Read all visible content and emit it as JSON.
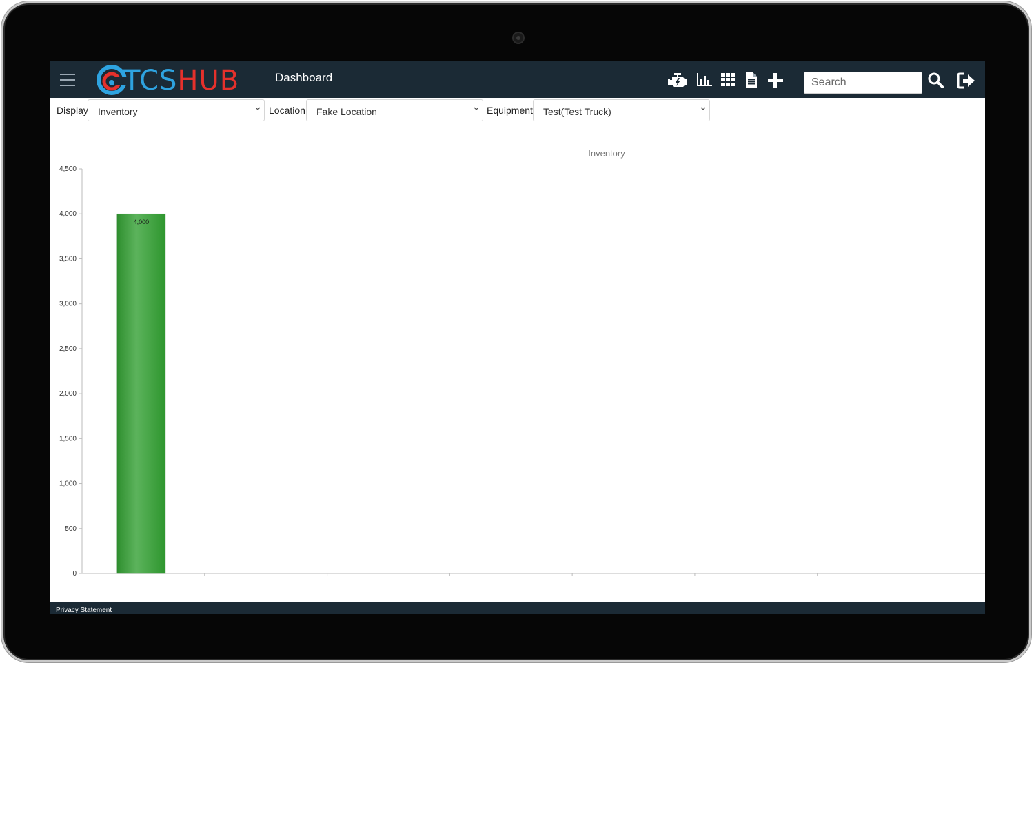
{
  "header": {
    "logo_text_left": "TCS",
    "logo_text_right": "HUB",
    "title": "Dashboard",
    "icons": [
      "engine-icon",
      "bar-chart-icon",
      "grid-icon",
      "document-icon",
      "plus-icon"
    ],
    "search_placeholder": "Search"
  },
  "filters": {
    "display_label": "Display",
    "display_value": "Inventory",
    "location_label": "Location",
    "location_value": "Fake Location",
    "equipment_label": "Equipment",
    "equipment_value": "Test(Test Truck)"
  },
  "chart_data": {
    "type": "bar",
    "title": "Inventory",
    "categories": [
      "",
      "",
      "",
      "",
      "",
      "",
      ""
    ],
    "values": [
      4000,
      null,
      null,
      null,
      null,
      null,
      null
    ],
    "data_labels": [
      "4,000",
      "",
      "",
      "",
      "",
      "",
      ""
    ],
    "yticks": [
      "0",
      "500",
      "1,000",
      "1,500",
      "2,000",
      "2,500",
      "3,000",
      "3,500",
      "4,000",
      "4,500"
    ],
    "ylim": [
      0,
      4500
    ],
    "xlabel": "",
    "ylabel": "",
    "grid": false,
    "bar_color": "#3a9a3a"
  },
  "footer": {
    "privacy_label": "Privacy Statement"
  },
  "colors": {
    "topbar": "#1b2a35",
    "logo_blue": "#2ea3e0",
    "logo_red": "#e5312c"
  }
}
